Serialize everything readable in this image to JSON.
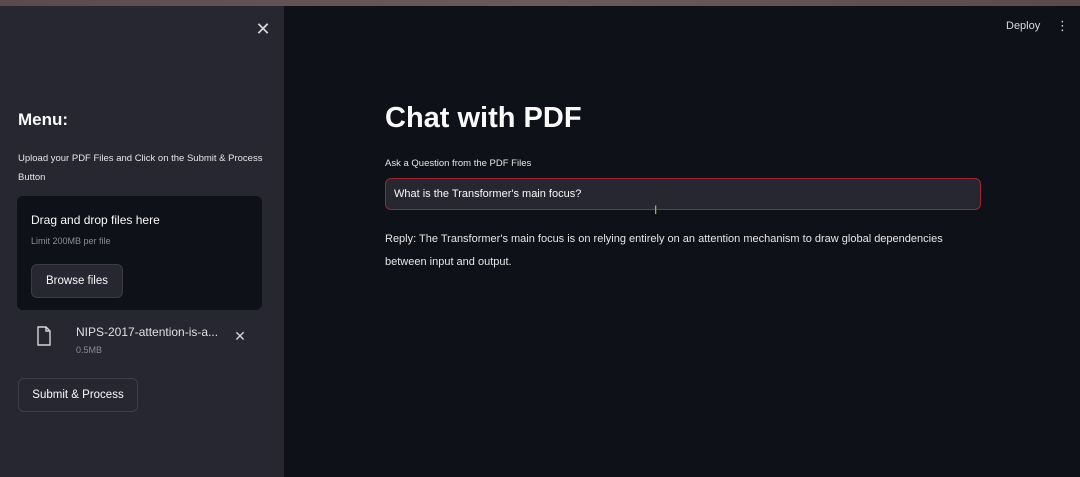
{
  "sidebar": {
    "menu_title": "Menu:",
    "upload_label": "Upload your PDF Files and Click on the Submit & Process Button",
    "dropzone": {
      "title": "Drag and drop files here",
      "limit": "Limit 200MB per file",
      "browse_label": "Browse files"
    },
    "file": {
      "name": "NIPS-2017-attention-is-a...",
      "size": "0.5MB",
      "icon": "document-icon"
    },
    "submit_label": "Submit & Process",
    "close_icon": "close-icon"
  },
  "header": {
    "deploy_label": "Deploy",
    "menu_icon": "kebab-menu-icon"
  },
  "main": {
    "title": "Chat with PDF",
    "question_label": "Ask a Question from the PDF Files",
    "question_value": "What is the Transformer's main focus?",
    "reply": "Reply: The Transformer's main focus is on relying entirely on an attention mechanism to draw global dependencies between input and output."
  },
  "colors": {
    "sidebar_bg": "#262730",
    "main_bg": "#0e1117",
    "input_focus_border": "#9c2532",
    "text": "#fafafa"
  }
}
